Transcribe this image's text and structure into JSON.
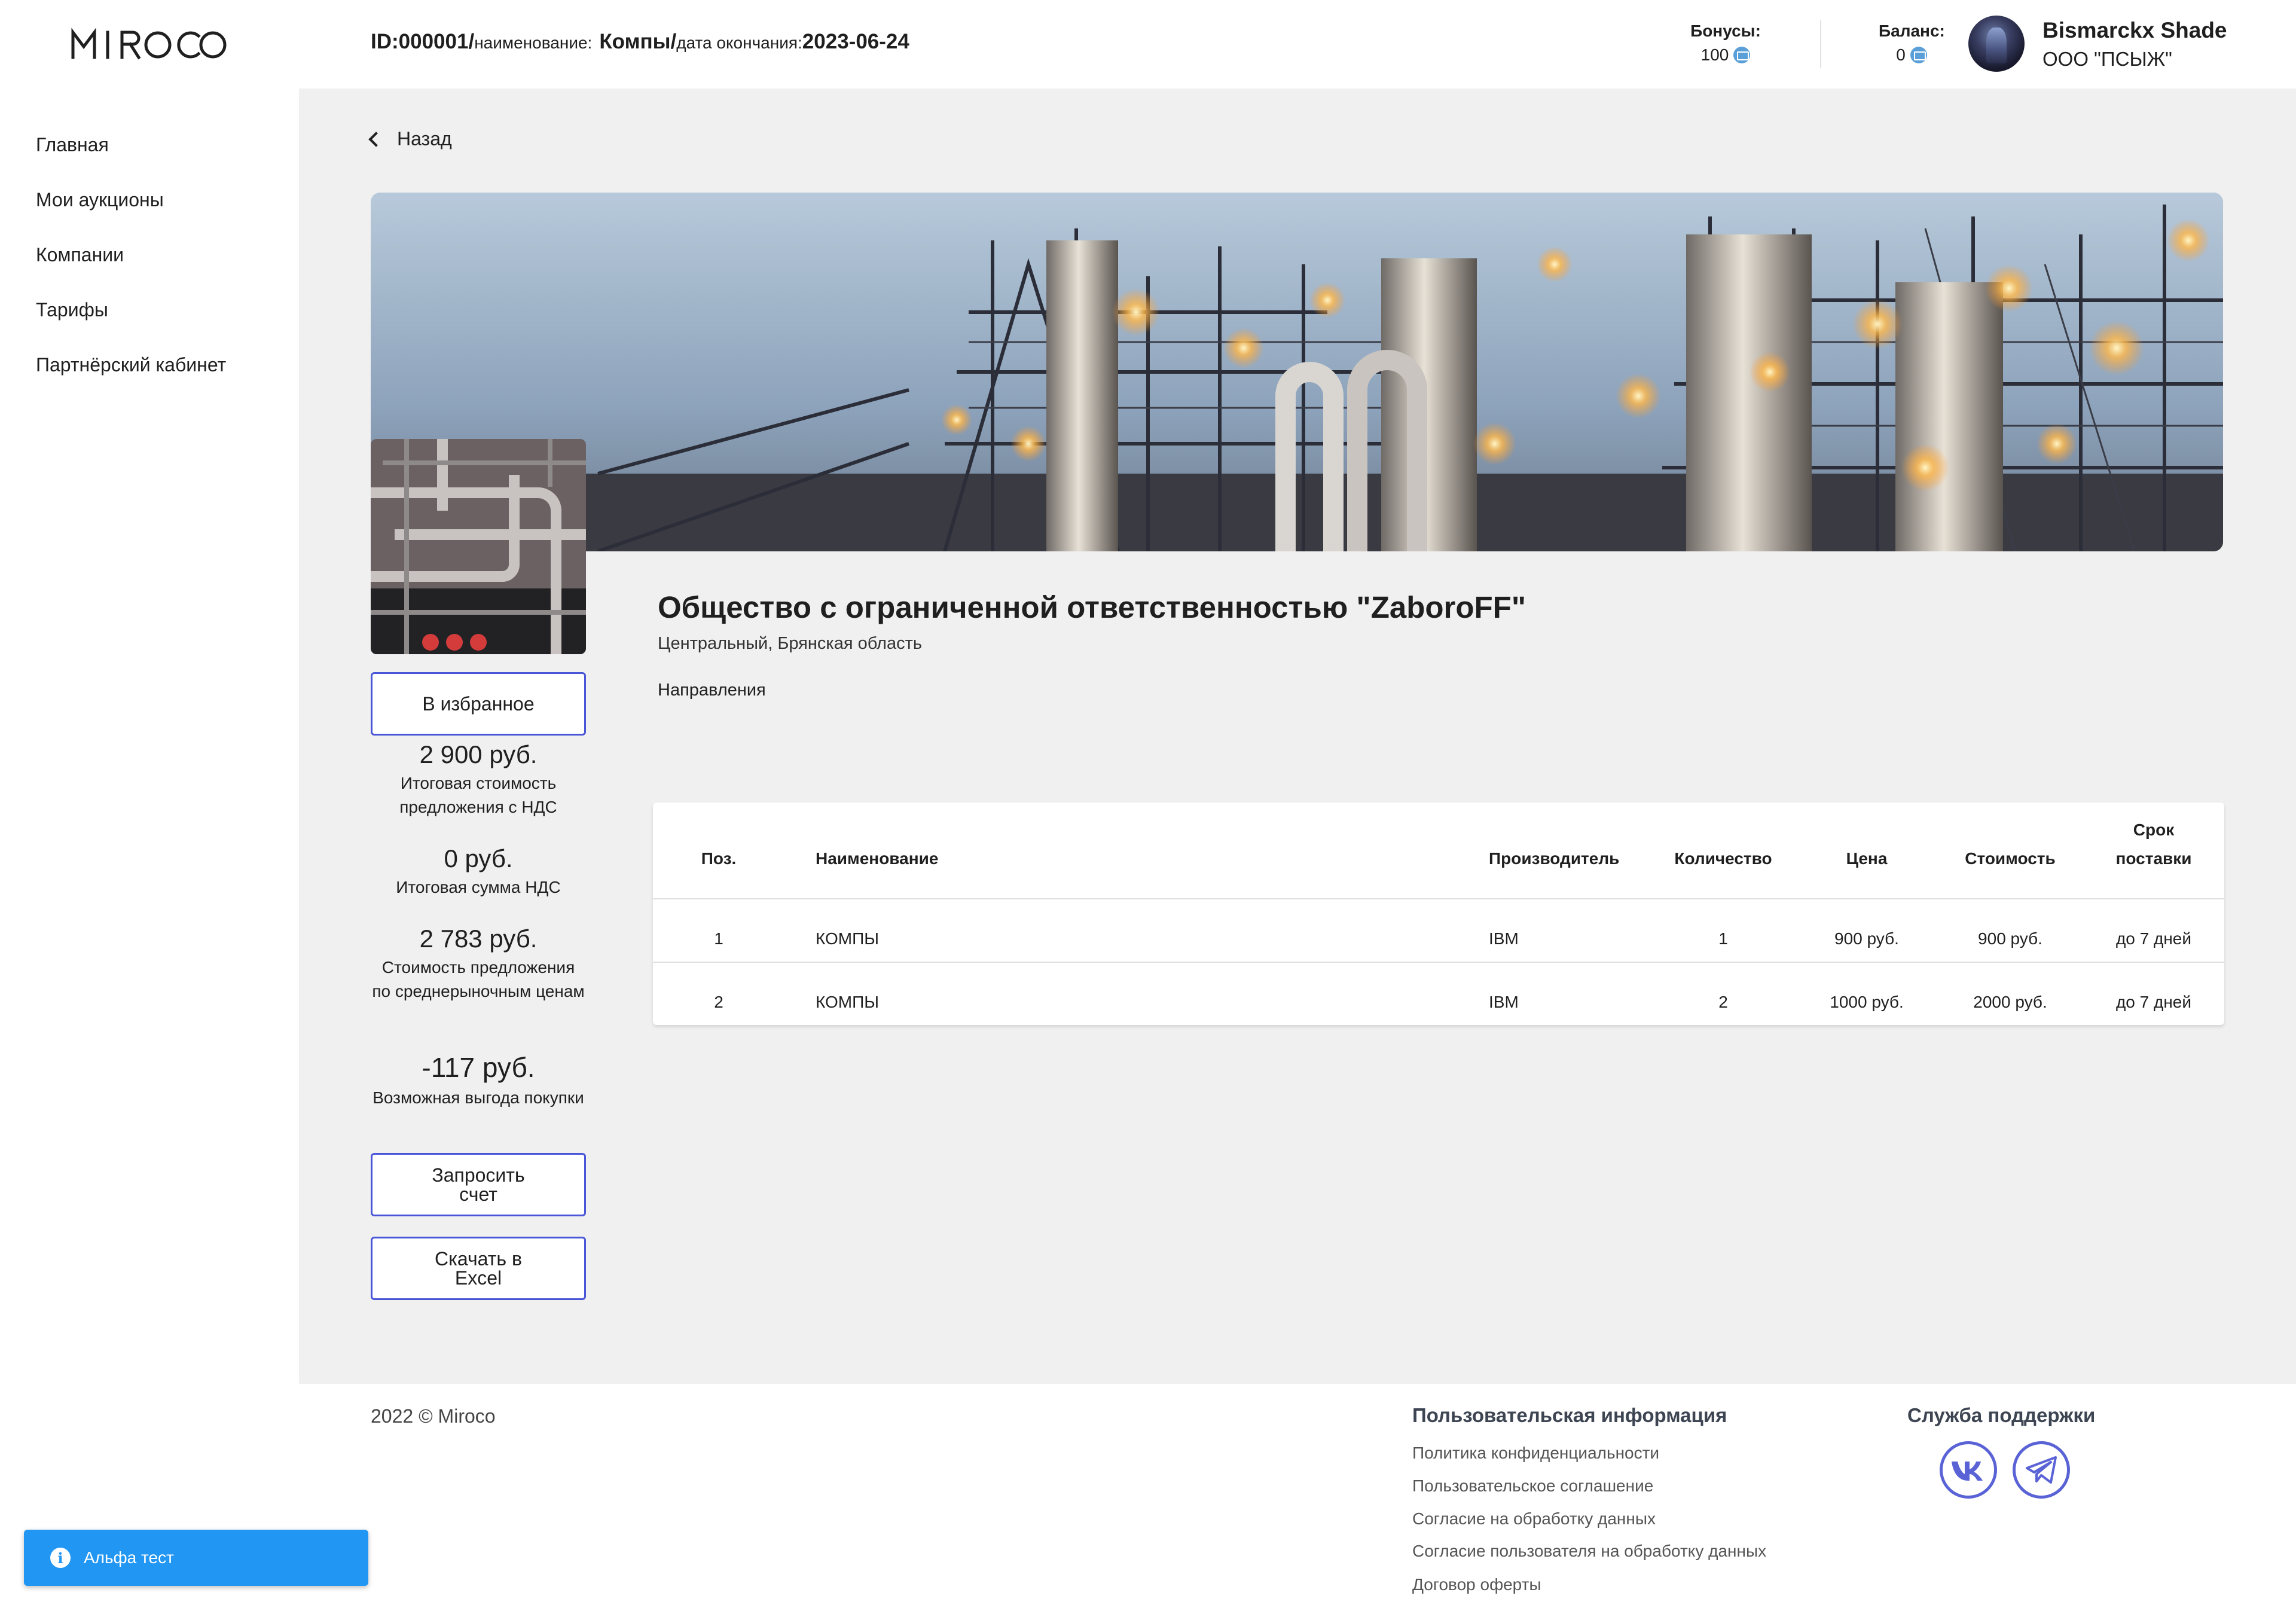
{
  "header": {
    "logo_text": "MIROCO",
    "id_label": "ID:",
    "id_value": "000001/",
    "name_label": "наименование:",
    "name_value": "Компы/",
    "end_label": "дата окончания:",
    "end_value": "2023-06-24",
    "bonus_label": "Бонусы:",
    "bonus_value": "100",
    "balance_label": "Баланс:",
    "balance_value": "0",
    "user_name": "Bismarckx Shade",
    "user_org": "ООО \"ПСЫЖ\""
  },
  "sidebar": {
    "items": [
      {
        "label": "Главная"
      },
      {
        "label": "Мои аукционы"
      },
      {
        "label": "Компании"
      },
      {
        "label": "Тарифы"
      },
      {
        "label": "Партнёрский кабинет"
      }
    ]
  },
  "main": {
    "back_label": "Назад",
    "favorite_label": "В избранное",
    "total_price": "2 900 руб.",
    "total_price_caption": "Итоговая стоимость предложения с НДС",
    "vat_sum": "0 руб.",
    "vat_sum_caption": "Итоговая сумма НДС",
    "market_price": "2 783 руб.",
    "market_price_caption": "Стоимость предложения по среднерыночным ценам",
    "benefit": "-117 руб.",
    "benefit_caption": "Возможная выгода покупки",
    "invoice_label": "Запросить счет",
    "excel_label": "Скачать в Excel",
    "company_name": "Общество с ограниченной ответственностью \"ZaboroFF\"",
    "company_region": "Центральный, Брянская область",
    "directions_label": "Направления"
  },
  "table": {
    "headers": {
      "pos": "Поз.",
      "name": "Наименование",
      "maker": "Производитель",
      "qty": "Количество",
      "price": "Цена",
      "cost": "Стоимость",
      "term_1": "Срок",
      "term_2": "поставки"
    },
    "rows": [
      {
        "pos": "1",
        "name": "КОМПЫ",
        "maker": "IBM",
        "qty": "1",
        "price": "900 руб.",
        "cost": "900 руб.",
        "term": "до 7 дней"
      },
      {
        "pos": "2",
        "name": "КОМПЫ",
        "maker": "IBM",
        "qty": "2",
        "price": "1000 руб.",
        "cost": "2000 руб.",
        "term": "до 7 дней"
      }
    ]
  },
  "footer": {
    "copyright": "2022 © Miroco",
    "user_info_title": "Пользовательская информация",
    "links": [
      "Политика конфиденциальности",
      "Пользовательское соглашение",
      "Согласие на обработку данных",
      "Согласие пользователя на обработку данных",
      "Договор оферты"
    ],
    "support_title": "Служба поддержки",
    "social_icons": [
      "vk-icon",
      "telegram-icon"
    ]
  },
  "toast": {
    "label": "Альфа тест"
  },
  "colors": {
    "accent": "#4a56d8",
    "toast": "#2196f3",
    "main_bg": "#f0f0f0"
  }
}
